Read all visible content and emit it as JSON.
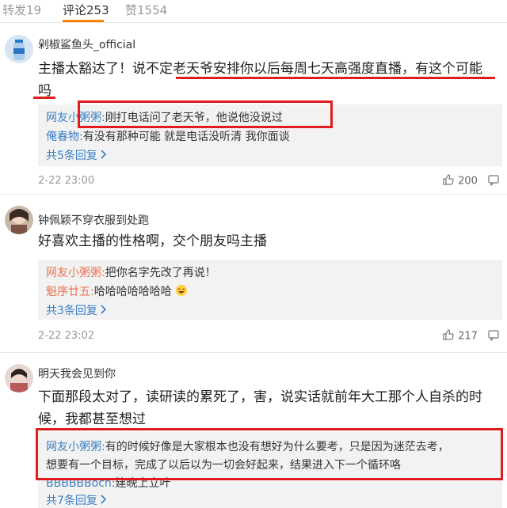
{
  "tabs": [
    {
      "label": "转发19"
    },
    {
      "label": "评论253"
    },
    {
      "label": "赞1554"
    }
  ],
  "comments": [
    {
      "user": "剁椒鲨鱼头_official",
      "text_line1": "主播太豁达了！说不定老天爷安排你以后每周七天高强度直播，有这个可能",
      "text_line2": "吗",
      "replies": [
        {
          "name": "网友小粥粥:",
          "text": "刚打电话问了老天爷，他说他没说过"
        },
        {
          "name": "俺春物:",
          "text": "有没有那种可能 就是电话没听清 我你面谈"
        }
      ],
      "more": "共5条回复",
      "time": "2-22 23:00",
      "likes": "200"
    },
    {
      "user": "钟佩颖不穿衣服到处跑",
      "text_line1": "好喜欢主播的性格啊，交个朋友吗主播",
      "replies": [
        {
          "name": "网友小粥粥:",
          "text": "把你名字先改了再说！"
        },
        {
          "name": "魁序廿五:",
          "text": "哈哈哈哈哈哈哈"
        }
      ],
      "more": "共3条回复",
      "time": "2-22 23:02",
      "likes": "217"
    },
    {
      "user": "明天我会见到你",
      "text_line1": "下面那段太对了，读研读的累死了，害，说实话就前年大工那个人自杀的时",
      "text_line2": "候，我都甚至想过",
      "replies": [
        {
          "name": "网友小粥粥:",
          "text": "有的时候好像是大家根本也没有想好为什么要考，只是因为迷茫去考，"
        },
        {
          "name": "",
          "text": "想要有一个目标，完成了以后以为一切会好起来，结果进入下一个循环咯"
        },
        {
          "name": "BBBBBBoch:",
          "text": "建晚上立叶"
        }
      ],
      "more": "共7条回复"
    }
  ],
  "colors": {
    "accent_orange": "#ff8200",
    "reply_name": "#eb7350",
    "link_blue": "#3b7fc4",
    "highlight_red": "#e01c1c",
    "reply_bg": "#f2f2f2"
  }
}
